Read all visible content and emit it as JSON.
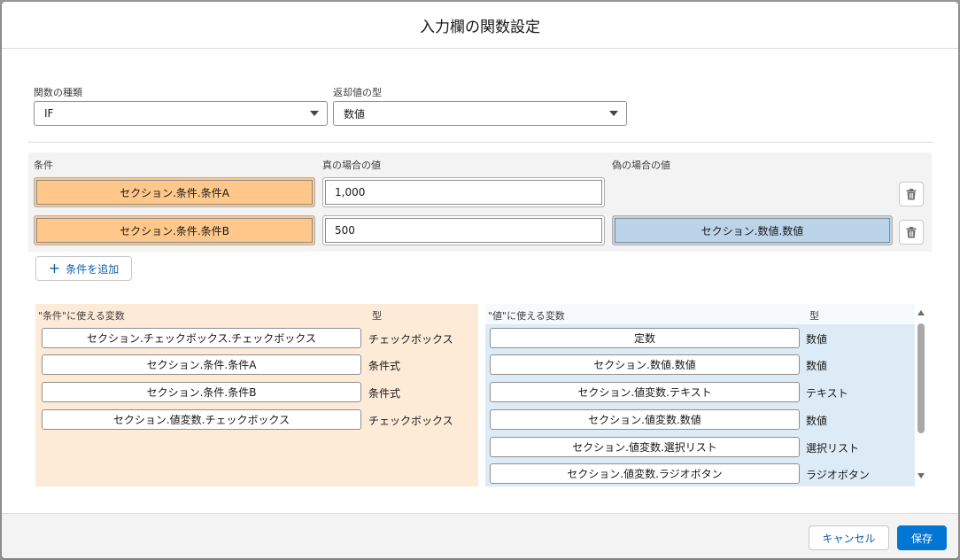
{
  "dialog": {
    "title": "入力欄の関数設定"
  },
  "function_type": {
    "label": "関数の種類",
    "value": "IF"
  },
  "return_type": {
    "label": "返却値の型",
    "value": "数値"
  },
  "conditions": {
    "headers": {
      "condition": "条件",
      "true_value": "真の場合の値",
      "false_value": "偽の場合の値"
    },
    "rows": [
      {
        "condition": "セクション.条件.条件A",
        "true_value": "1,000",
        "false_value": ""
      },
      {
        "condition": "セクション.条件.条件B",
        "true_value": "500",
        "false_value": "セクション.数値.数値"
      }
    ],
    "add_label": "条件を追加"
  },
  "condition_vars": {
    "header": "\"条件\"に使える変数",
    "type_header": "型",
    "items": [
      {
        "name": "セクション.チェックボックス.チェックボックス",
        "type": "チェックボックス"
      },
      {
        "name": "セクション.条件.条件A",
        "type": "条件式"
      },
      {
        "name": "セクション.条件.条件B",
        "type": "条件式"
      },
      {
        "name": "セクション.値変数.チェックボックス",
        "type": "チェックボックス"
      }
    ]
  },
  "value_vars": {
    "header": "\"値\"に使える変数",
    "type_header": "型",
    "items": [
      {
        "name": "定数",
        "type": "数値"
      },
      {
        "name": "セクション.数値.数値",
        "type": "数値"
      },
      {
        "name": "セクション.値変数.テキスト",
        "type": "テキスト"
      },
      {
        "name": "セクション.値変数.数値",
        "type": "数値"
      },
      {
        "name": "セクション.値変数.選択リスト",
        "type": "選択リスト"
      },
      {
        "name": "セクション.値変数.ラジオボタン",
        "type": "ラジオボタン"
      }
    ]
  },
  "footer": {
    "cancel_label": "キャンセル",
    "save_label": "保存"
  },
  "colors": {
    "condition_pill": "#ffc78a",
    "value_pill": "#bcd4ea",
    "condition_panel": "#fdebd8",
    "value_panel": "#ddebf6",
    "brand_blue": "#0176d3"
  }
}
